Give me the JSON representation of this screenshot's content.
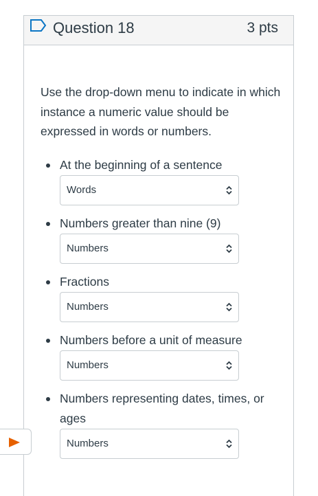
{
  "question": {
    "title": "Question 18",
    "points": "3 pts",
    "prompt": "Use the drop-down menu to indicate in which instance a numeric value should be expressed in words or numbers."
  },
  "items": [
    {
      "label": "At the beginning of a sentence",
      "selected": "Words"
    },
    {
      "label": "Numbers greater than nine (9)",
      "selected": "Numbers"
    },
    {
      "label": "Fractions",
      "selected": "Numbers"
    },
    {
      "label": "Numbers before a unit of measure",
      "selected": "Numbers"
    },
    {
      "label": "Numbers representing dates, times, or ages",
      "selected": "Numbers"
    }
  ],
  "icons": {
    "flag": "bookmark-flag-icon",
    "caret": "up-down-chevron-icon",
    "marker": "play-triangle-icon"
  },
  "colors": {
    "flag": "#0b75c4",
    "marker": "#e66000",
    "text": "#2d3b45",
    "border": "#c7cdd1"
  }
}
